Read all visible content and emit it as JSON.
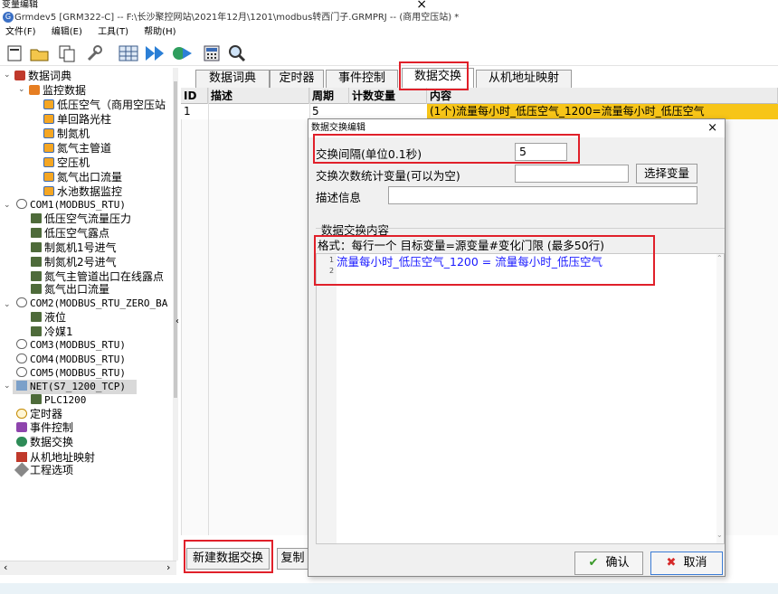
{
  "outer_window": {
    "title": "变量编辑",
    "close": "×"
  },
  "app": {
    "logo": "G",
    "title": "Grmdev5 [GRM322-C] -- F:\\长沙聚控网站\\2021年12月\\1201\\modbus转西门子.GRMPRJ -- (商用空压站) *"
  },
  "menu": [
    "文件(F)",
    "编辑(E)",
    "工具(T)",
    "帮助(H)"
  ],
  "toolbar": [
    "new-file-icon",
    "open-folder-icon",
    "copy-icon",
    "wrench-icon",
    "grid-icon",
    "forward-icon",
    "transfer-icon",
    "calculator-icon",
    "search-icon"
  ],
  "tree": {
    "root": "数据词典",
    "monitor": "监控数据",
    "monitor_items": [
      "低压空气（商用空压站",
      "单回路光柱",
      "制氮机",
      "氮气主管道",
      "空压机",
      "氮气出口流量",
      "水池数据监控"
    ],
    "com1": "COM1(MODBUS_RTU)",
    "com1_items": [
      "低压空气流量压力",
      "低压空气露点",
      "制氮机1号进气",
      "制氮机2号进气",
      "氮气主管道出口在线露点",
      "氮气出口流量"
    ],
    "com2": "COM2(MODBUS_RTU_ZERO_BA",
    "com2_items": [
      "液位",
      "冷媒1"
    ],
    "com3": "COM3(MODBUS_RTU)",
    "com4": "COM4(MODBUS_RTU)",
    "com5": "COM5(MODBUS_RTU)",
    "net": "NET(S7_1200_TCP)",
    "plc": "PLC1200",
    "timer": "定时器",
    "event": "事件控制",
    "exchange": "数据交换",
    "slave": "从机地址映射",
    "options": "工程选项"
  },
  "tabs": [
    "数据词典",
    "定时器",
    "事件控制",
    "数据交换",
    "从机地址映射"
  ],
  "list": {
    "headers": [
      "ID",
      "描述",
      "周期",
      "计数变量",
      "内容"
    ],
    "row": {
      "id": "1",
      "desc": "",
      "period": "5",
      "counter": "",
      "content": "(1个)流量每小时_低压空气_1200=流量每小时_低压空气"
    }
  },
  "buttons": {
    "new_exchange": "新建数据交换",
    "copy": "复制"
  },
  "dialog": {
    "title": "数据交换编辑",
    "close": "×",
    "interval_label": "交换间隔(单位0.1秒)",
    "interval_value": "5",
    "counter_label": "交换次数统计变量(可以为空)",
    "counter_value": "",
    "select_var": "选择变量",
    "desc_label": "描述信息",
    "desc_value": "",
    "content_group": "数据交换内容",
    "format_hint": "格式：每行一个 目标变量=源变量#变化门限 (最多50行)",
    "line_numbers": [
      "1",
      "2"
    ],
    "code_line1": "流量每小时_低压空气_1200 = 流量每小时_低压空气",
    "ok": "确认",
    "cancel": "取消"
  },
  "colors": {
    "highlight": "#f7c518",
    "annotation": "#e0202a",
    "code": "#1a1aff"
  }
}
